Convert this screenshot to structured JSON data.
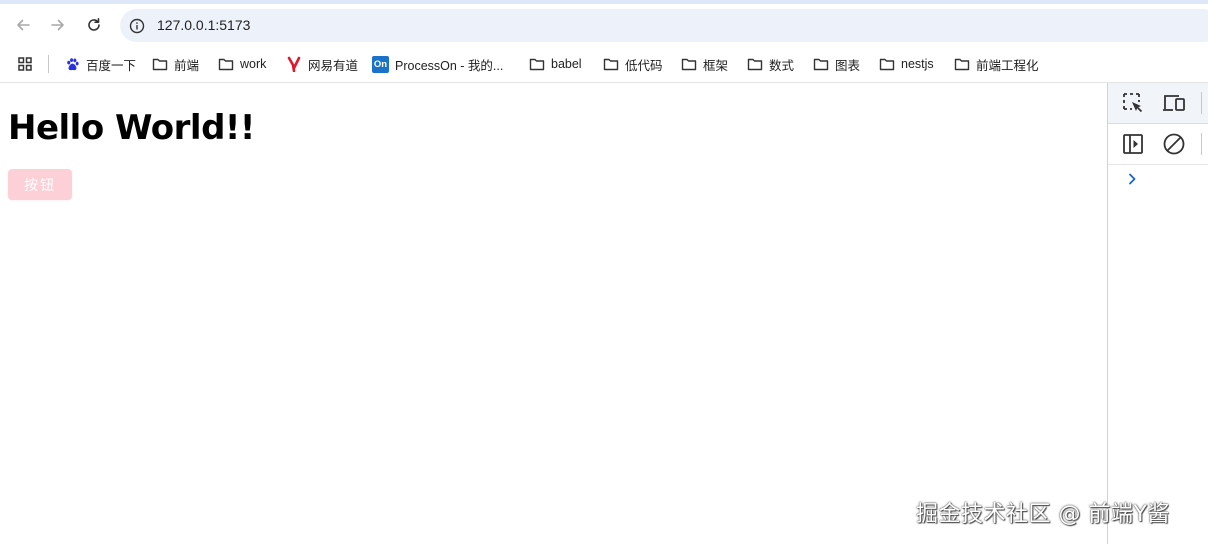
{
  "browser": {
    "url": "127.0.0.1:5173",
    "accent_color": "#dfe8fa",
    "omnibox_color": "#edf2fa"
  },
  "nav": {
    "back_icon": "arrow-left-icon",
    "forward_icon": "arrow-right-icon",
    "reload_icon": "reload-icon",
    "info_icon": "info-icon"
  },
  "bookmarks": [
    {
      "label": "百度一下",
      "icon": "baidu-paw-icon"
    },
    {
      "label": "前端",
      "icon": "folder-icon"
    },
    {
      "label": "work",
      "icon": "folder-icon"
    },
    {
      "label": "网易有道",
      "icon": "youdao-icon"
    },
    {
      "label": "ProcessOn - 我的...",
      "icon": "processon-icon",
      "badge": "On"
    },
    {
      "label": "babel",
      "icon": "folder-icon"
    },
    {
      "label": "低代码",
      "icon": "folder-icon"
    },
    {
      "label": "框架",
      "icon": "folder-icon"
    },
    {
      "label": "数式",
      "icon": "folder-icon"
    },
    {
      "label": "图表",
      "icon": "folder-icon"
    },
    {
      "label": "nestjs",
      "icon": "folder-icon"
    },
    {
      "label": "前端工程化",
      "icon": "folder-icon"
    }
  ],
  "page": {
    "heading": "Hello World!!",
    "button_label": "按钮",
    "button_color": "#fdd0d7"
  },
  "devtools": {
    "icons": [
      "inspect-element-icon",
      "device-toolbar-icon",
      "sidebar-toggle-icon",
      "clear-console-icon",
      "chevron-right-icon"
    ]
  },
  "watermark": "掘金技术社区 @ 前端Y酱"
}
